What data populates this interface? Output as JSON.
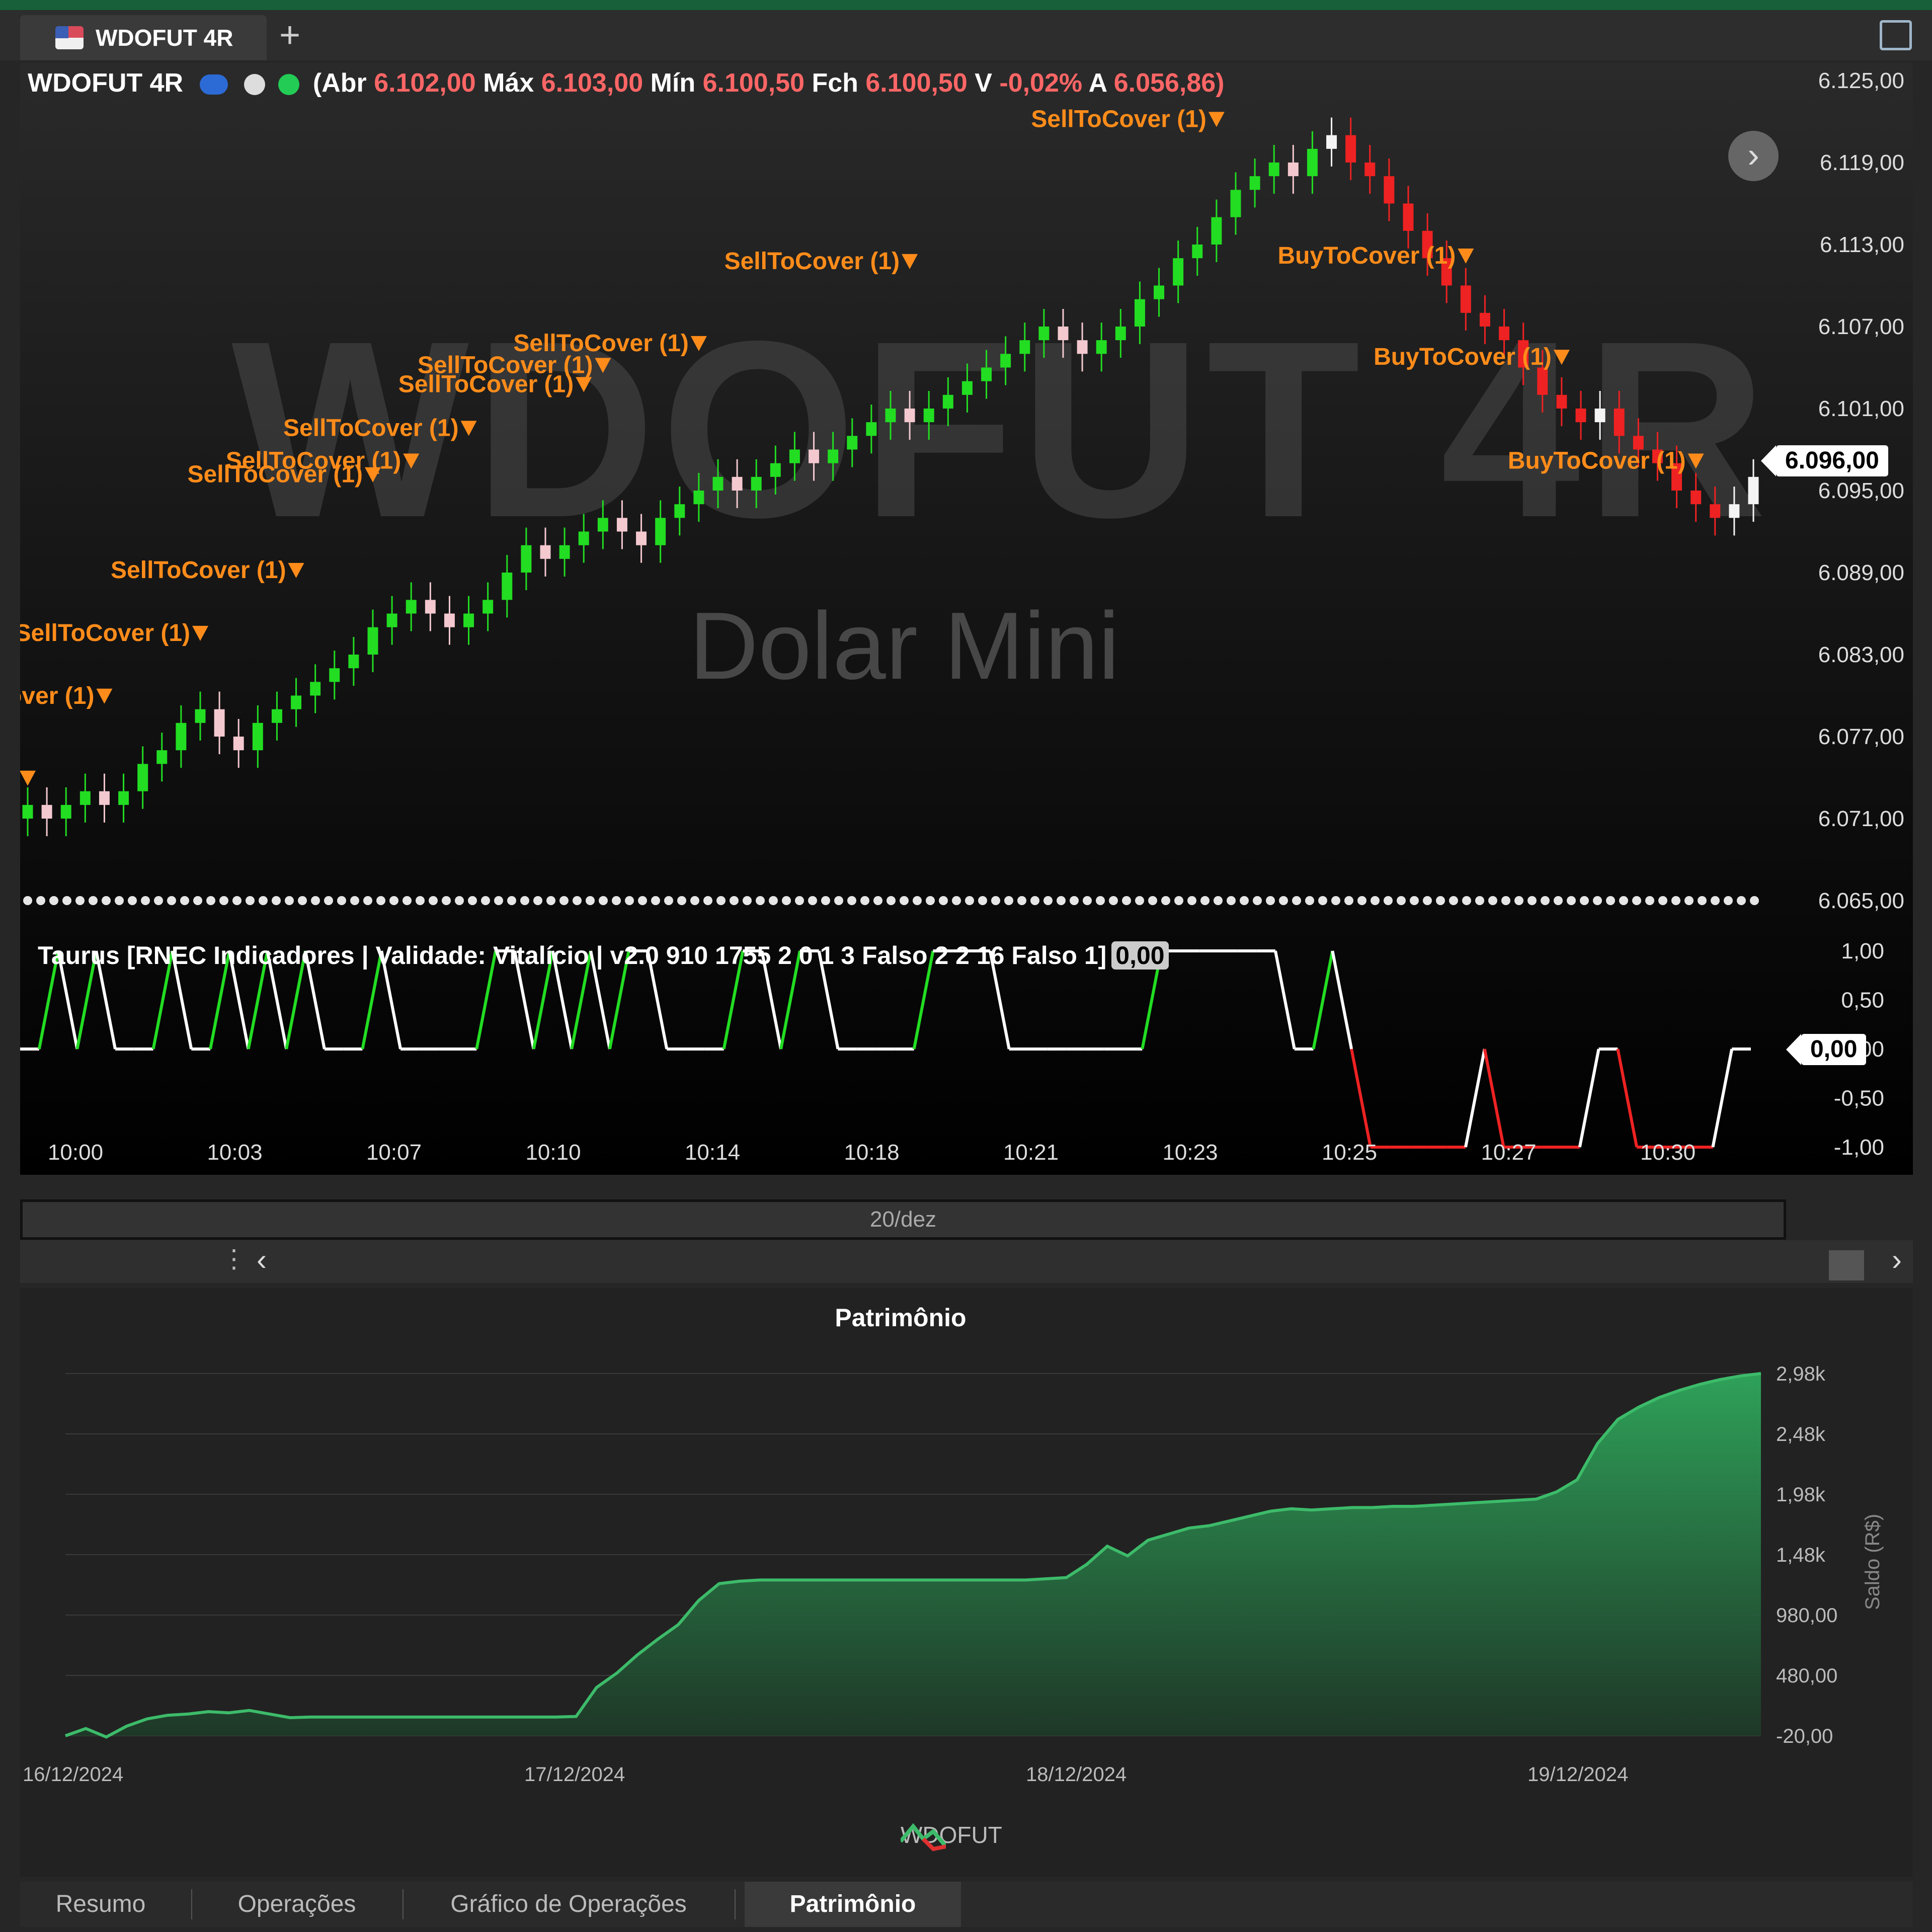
{
  "tab": {
    "title": "WDOFUT 4R",
    "add_label": "+"
  },
  "header": {
    "symbol": "WDOFUT 4R",
    "open_label": "(Abr",
    "open": "6.102,00",
    "high_label": "Máx",
    "high": "6.103,00",
    "low_label": "Mín",
    "low": "6.100,50",
    "close_label": "Fch",
    "close": "6.100,50",
    "var_label": "V",
    "var": "-0,02%",
    "prev_label": "A",
    "prev": "6.056,86)"
  },
  "watermark": {
    "big": "WDOFUT 4R",
    "small": "Dolar Mini"
  },
  "nav_next": "›",
  "last_price": "6.096,00",
  "indicator": {
    "title": "Taurus [RNEC Indicadores | Validade: Vitalício | v2.0  910 1755 2   0 1 3 Falso    2  2 16 Falso   1]",
    "value": "0,00",
    "current_tag": "0,00"
  },
  "date_bar": "20/dez",
  "colors": {
    "up": "#22dd22",
    "down": "#ee2222",
    "sell_cover": "#ff8c1a",
    "equity": "#3dbb6a"
  },
  "chart_data": [
    {
      "type": "candlestick",
      "title": "WDOFUT 4R",
      "y_ticks": [
        "6.125,00",
        "6.119,00",
        "6.113,00",
        "6.107,00",
        "6.101,00",
        "6.095,00",
        "6.089,00",
        "6.083,00",
        "6.077,00",
        "6.071,00",
        "6.065,00"
      ],
      "ylim": [
        6065,
        6125
      ],
      "x_ticks": [
        "10:00",
        "10:03",
        "10:07",
        "10:10",
        "10:14",
        "10:18",
        "10:21",
        "10:23",
        "10:25",
        "10:27",
        "10:30"
      ],
      "bars": [
        6072,
        6071,
        6072,
        6073,
        6072,
        6073,
        6075,
        6076,
        6078,
        6079,
        6077,
        6076,
        6078,
        6079,
        6080,
        6081,
        6082,
        6083,
        6085,
        6086,
        6087,
        6086,
        6085,
        6086,
        6087,
        6089,
        6091,
        6090,
        6091,
        6092,
        6093,
        6092,
        6091,
        6093,
        6094,
        6095,
        6096,
        6095,
        6096,
        6097,
        6098,
        6097,
        6098,
        6099,
        6100,
        6101,
        6100,
        6101,
        6102,
        6103,
        6104,
        6105,
        6106,
        6107,
        6106,
        6105,
        6106,
        6107,
        6109,
        6110,
        6112,
        6113,
        6115,
        6117,
        6118,
        6119,
        6118,
        6120,
        6121,
        6119,
        6118,
        6116,
        6114,
        6112,
        6110,
        6108,
        6107,
        6106,
        6104,
        6102,
        6101,
        6100,
        6101,
        6099,
        6098,
        6097,
        6095,
        6094,
        6093,
        6094,
        6096
      ],
      "annotations": [
        {
          "text": "SellToCover (1)",
          "price": 6121.6,
          "bar": 62
        },
        {
          "text": "SellToCover (1)",
          "price": 6111.2,
          "bar": 46
        },
        {
          "text": "BuyToCover (1)",
          "price": 6111.6,
          "bar": 75
        },
        {
          "text": "SellToCover (1)",
          "price": 6105.2,
          "bar": 35
        },
        {
          "text": "SellToCover (1)",
          "price": 6103.6,
          "bar": 30
        },
        {
          "text": "SellToCover (1)",
          "price": 6102.2,
          "bar": 29
        },
        {
          "text": "BuyToCover (1)",
          "price": 6104.2,
          "bar": 80
        },
        {
          "text": "SellToCover (1)",
          "price": 6099.0,
          "bar": 23
        },
        {
          "text": "SellToCover (1)",
          "price": 6096.6,
          "bar": 20
        },
        {
          "text": "SellToCover (1)",
          "price": 6095.6,
          "bar": 18
        },
        {
          "text": "BuyToCover (1)",
          "price": 6096.6,
          "bar": 87
        },
        {
          "text": "SellToCover (1)",
          "price": 6088.6,
          "bar": 14
        },
        {
          "text": "SellToCover (1)",
          "price": 6084.0,
          "bar": 9
        },
        {
          "text": "SellToCover (1)",
          "price": 6079.4,
          "bar": 4
        },
        {
          "text": "over (1)",
          "price": 6073.4,
          "bar": 0
        }
      ]
    },
    {
      "type": "line",
      "title": "Taurus",
      "y_ticks": [
        "1,00",
        "0,50",
        "0,00",
        "-0,50",
        "-1,00"
      ],
      "ylim": [
        -1,
        1
      ],
      "values": [
        0,
        0,
        1,
        0,
        1,
        0,
        0,
        0,
        1,
        0,
        0,
        1,
        0,
        1,
        0,
        1,
        0,
        0,
        0,
        1,
        0,
        0,
        0,
        0,
        0,
        1,
        1,
        0,
        1,
        0,
        1,
        0,
        1,
        1,
        0,
        0,
        0,
        0,
        1,
        1,
        0,
        1,
        1,
        0,
        0,
        0,
        0,
        0,
        1,
        1,
        1,
        1,
        0,
        0,
        0,
        0,
        0,
        0,
        0,
        0,
        1,
        1,
        1,
        1,
        1,
        1,
        1,
        0,
        0,
        1,
        0,
        -1,
        -1,
        -1,
        -1,
        -1,
        -1,
        0,
        -1,
        -1,
        -1,
        -1,
        -1,
        0,
        0,
        -1,
        -1,
        -1,
        -1,
        -1,
        0,
        0
      ]
    },
    {
      "type": "area",
      "title": "Patrimônio",
      "series": [
        {
          "name": "WDOFUT"
        }
      ],
      "ylabel": "Saldo (R$)",
      "y_ticks": [
        "2,98k",
        "2,48k",
        "1,98k",
        "1,48k",
        "980,00",
        "480,00",
        "-20,00"
      ],
      "ylim": [
        -20,
        2980
      ],
      "x_ticks": [
        "16/12/2024",
        "17/12/2024",
        "18/12/2024",
        "19/12/2024"
      ],
      "values": [
        -20,
        40,
        -30,
        60,
        120,
        150,
        160,
        180,
        170,
        190,
        160,
        130,
        135,
        135,
        135,
        135,
        135,
        135,
        135,
        135,
        135,
        135,
        135,
        135,
        135,
        140,
        380,
        500,
        650,
        780,
        900,
        1100,
        1240,
        1260,
        1270,
        1270,
        1270,
        1270,
        1270,
        1270,
        1270,
        1270,
        1270,
        1270,
        1270,
        1270,
        1270,
        1270,
        1280,
        1290,
        1400,
        1550,
        1470,
        1600,
        1650,
        1700,
        1720,
        1760,
        1800,
        1840,
        1860,
        1850,
        1860,
        1870,
        1870,
        1880,
        1880,
        1890,
        1900,
        1910,
        1920,
        1930,
        1940,
        2000,
        2100,
        2400,
        2600,
        2700,
        2780,
        2840,
        2890,
        2930,
        2960,
        2980
      ]
    }
  ],
  "bottom_tabs": [
    "Resumo",
    "Operações",
    "Gráfico de Operações",
    "Patrimônio"
  ],
  "active_tab": "Patrimônio"
}
